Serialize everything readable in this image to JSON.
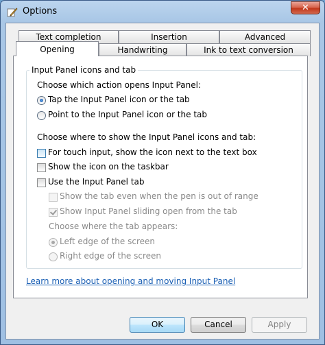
{
  "window": {
    "title": "Options",
    "close_glyph": "✕"
  },
  "tabs": {
    "row1": [
      "Text completion",
      "Insertion",
      "Advanced"
    ],
    "row2": [
      "Opening",
      "Handwriting",
      "Ink to text conversion"
    ],
    "active": "Opening"
  },
  "group": {
    "title": "Input Panel icons and tab",
    "action_prompt": "Choose which action opens Input Panel:",
    "radio_tap": "Tap the Input Panel icon or the tab",
    "radio_point": "Point to the Input Panel icon or the tab",
    "where_prompt": "Choose where to show the Input Panel icons and tab:",
    "check_touch": "For touch input, show the icon next to the text box",
    "check_taskbar": "Show the icon on the taskbar",
    "check_use_tab": "Use the Input Panel tab",
    "check_show_tab_out_of_range": "Show the tab even when the pen is out of range",
    "check_sliding": "Show Input Panel sliding open from the tab",
    "tab_appears_prompt": "Choose where the tab appears:",
    "radio_left_edge": "Left edge of the screen",
    "radio_right_edge": "Right edge of the screen"
  },
  "link": "Learn more about opening and moving Input Panel",
  "buttons": {
    "ok": "OK",
    "cancel": "Cancel",
    "apply": "Apply"
  },
  "icons": {
    "app": "pen-icon",
    "close": "close-icon"
  }
}
